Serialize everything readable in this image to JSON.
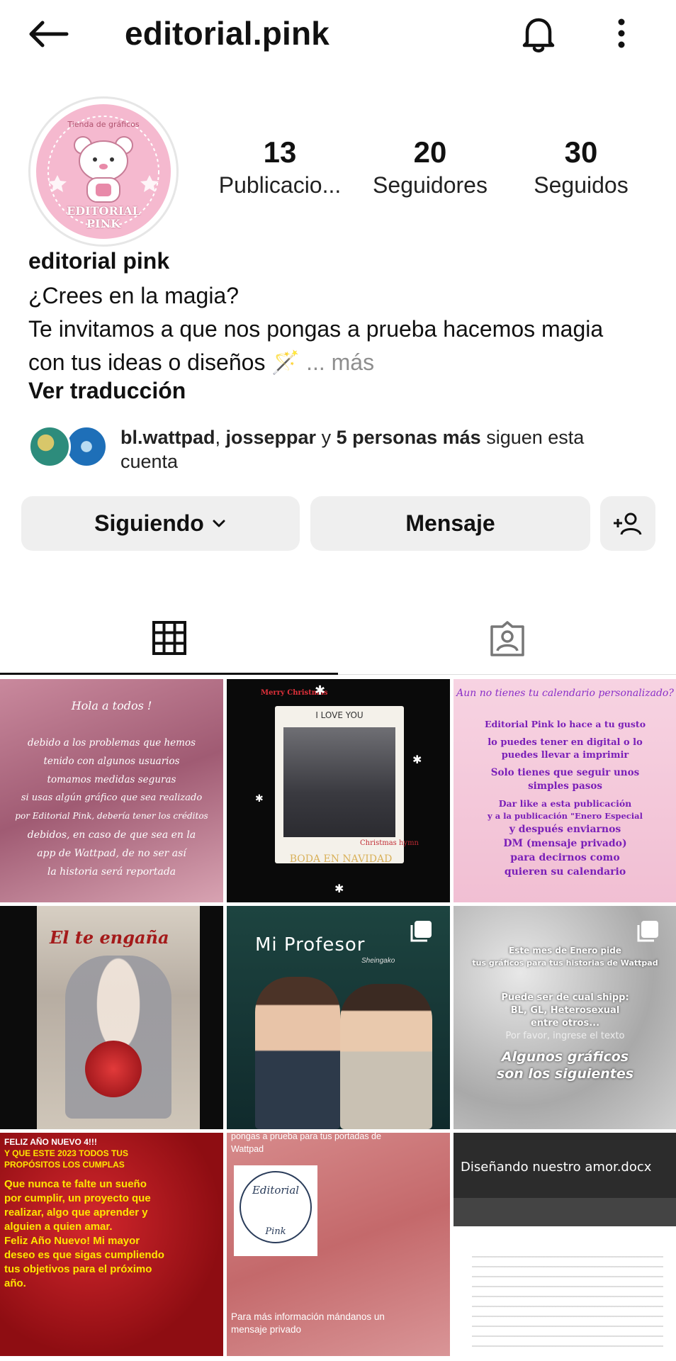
{
  "header": {
    "title": "editorial.pink"
  },
  "profile": {
    "avatar_text_top": "Tienda de gráficos",
    "avatar_text_bottom": "EDITORIAL PINK",
    "stats": [
      {
        "value": "13",
        "label": "Publicacio..."
      },
      {
        "value": "20",
        "label": "Seguidores"
      },
      {
        "value": "30",
        "label": "Seguidos"
      }
    ],
    "display_name": "editorial pink",
    "bio_line1": "¿Crees en la magia?",
    "bio_line2": "Te invitamos a que nos pongas a prueba hacemos magia",
    "bio_line3": "con tus ideas o diseños 🪄",
    "bio_more": "... más",
    "translate": "Ver traducción",
    "followed_by": {
      "user1": "bl.wattpad",
      "sep": ", ",
      "user2": "josseppar",
      "and": " y ",
      "others": "5 personas más",
      "suffix": " siguen esta cuenta"
    }
  },
  "actions": {
    "following": "Siguiendo",
    "message": "Mensaje"
  },
  "posts": {
    "p1": [
      "Hola a todos !",
      "debido a los problemas que hemos",
      "tenido con algunos usuarios",
      "tomamos medidas seguras",
      "si usas algún gráfico que sea realizado",
      "por Editorial Pink, debería tener los créditos",
      "debidos, en caso de que sea en la",
      "app de Wattpad, de no ser así",
      "la historia será reportada"
    ],
    "p2": [
      "Merry Christmas",
      "I LOVE YOU",
      "BODA EN NAVIDAD",
      "Christmas hymn"
    ],
    "p3": [
      "Aun no tienes tu calendario personalizado?",
      "Editorial Pink lo hace a tu gusto",
      "lo puedes tener en digital o lo",
      "puedes llevar a imprimir",
      "Solo tienes que seguir unos",
      "simples pasos",
      "Dar like a esta publicación",
      "y a la publicación \"Enero Especial",
      "y después enviarnos",
      "DM (mensaje privado)",
      "para decirnos como",
      "quieren su calendario"
    ],
    "p4": [
      "El te engaña"
    ],
    "p5": [
      "Mi Profesor",
      "Sheingako"
    ],
    "p6": [
      "Este mes de Enero pide",
      "tus gráficos para tus historias de Wattpad",
      "Puede ser de cual shipp:",
      "BL, GL, Heterosexual",
      "entre otros...",
      "Por favor, ingrese el texto",
      "Algunos gráficos",
      "son los siguientes"
    ],
    "p7": [
      "FELIZ AÑO NUEVO 4!!!",
      "Y QUE ESTE 2023 TODOS TUS",
      "PROPÓSITOS LOS CUMPLAS",
      "Que nunca te falte un sueño",
      "por cumplir, un proyecto que",
      "realizar, algo que aprender y",
      "alguien a quien amar.",
      "Feliz Año Nuevo! Mi mayor",
      "deseo es que sigas cumpliendo",
      "tus objetivos para el próximo",
      "año."
    ],
    "p8": [
      "pongas a prueba para tus portadas de",
      "Wattpad",
      "Editorial",
      "Pink",
      "Para más información mándanos un",
      "mensaje privado"
    ],
    "p9": [
      "Diseñando nuestro amor.docx"
    ]
  },
  "colors": {
    "accent_pink": "#f5b9cf",
    "button_bg": "#efefef",
    "muted": "#8e8e8e"
  }
}
